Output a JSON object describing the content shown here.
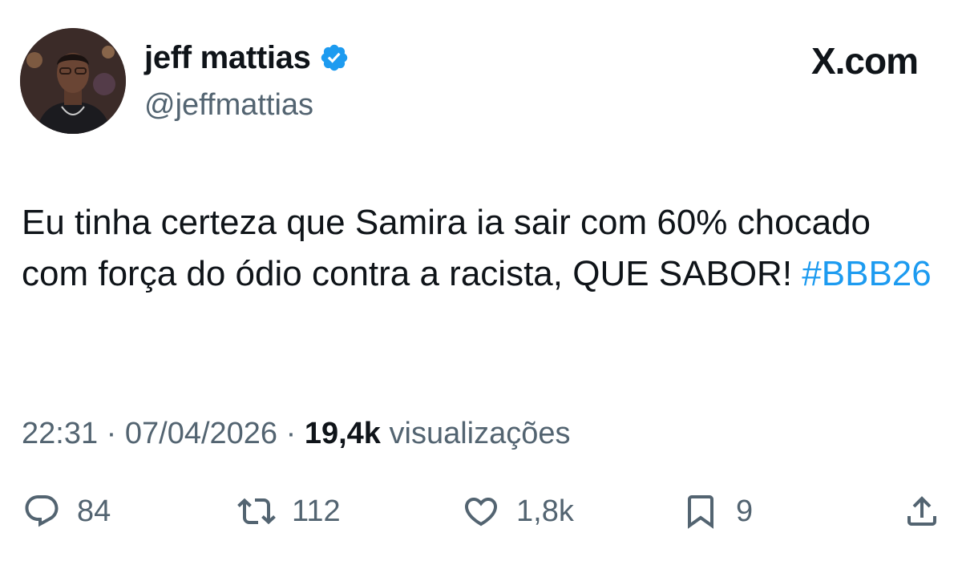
{
  "author": {
    "display_name": "jeff mattias",
    "handle": "@jeffmattias",
    "verified": true,
    "avatar": "profile-photo"
  },
  "brand": "X.com",
  "tweet": {
    "text": "Eu tinha certeza que Samira ia sair com 60% chocado com força do ódio contra a racista, QUE SABOR! ",
    "hashtag": "#BBB26"
  },
  "meta": {
    "time": "22:31",
    "separator1": " · ",
    "date": "07/04/2026",
    "separator2": " · ",
    "views": "19,4k",
    "views_label": " visualizações"
  },
  "actions": {
    "replies": {
      "icon": "reply-icon",
      "count": "84"
    },
    "reposts": {
      "icon": "repost-icon",
      "count": "112"
    },
    "likes": {
      "icon": "heart-icon",
      "count": "1,8k"
    },
    "bookmarks": {
      "icon": "bookmark-icon",
      "count": "9"
    },
    "share": {
      "icon": "share-icon"
    }
  },
  "colors": {
    "text": "#0f1419",
    "secondary": "#536471",
    "accent": "#1d9bf0"
  }
}
